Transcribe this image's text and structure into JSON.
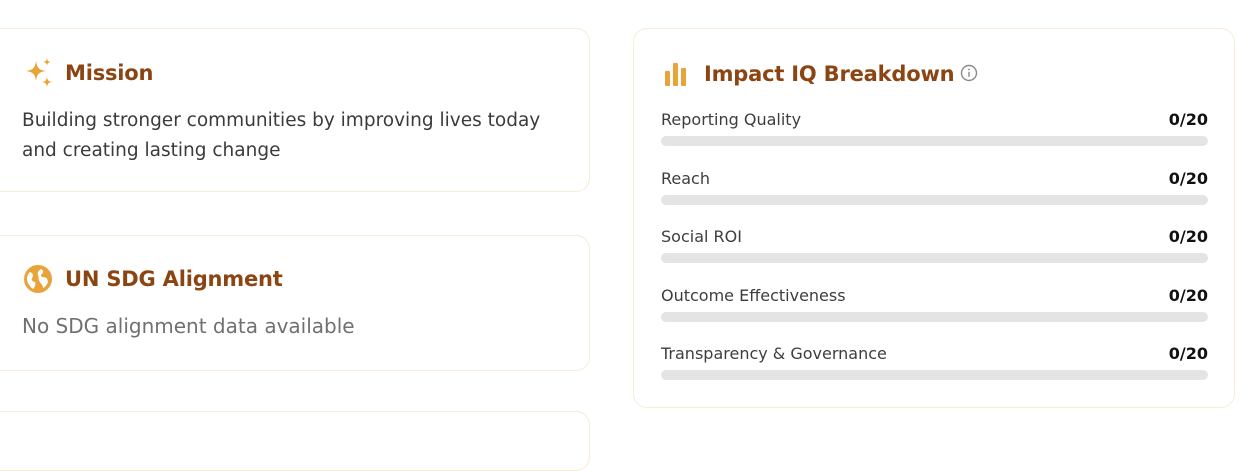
{
  "mission": {
    "title": "Mission",
    "text": "Building stronger communities by improving lives today and creating lasting change",
    "icon": "sparkles-icon"
  },
  "sdg": {
    "title": "UN SDG Alignment",
    "empty_text": "No SDG alignment data available",
    "icon": "globe-icon"
  },
  "impact": {
    "title": "Impact IQ Breakdown",
    "icon": "bar-chart-icon",
    "info_icon": "info-icon",
    "metrics": [
      {
        "label": "Reporting Quality",
        "score": "0/20",
        "fraction": 0
      },
      {
        "label": "Reach",
        "score": "0/20",
        "fraction": 0
      },
      {
        "label": "Social ROI",
        "score": "0/20",
        "fraction": 0
      },
      {
        "label": "Outcome Effectiveness",
        "score": "0/20",
        "fraction": 0
      },
      {
        "label": "Transparency & Governance",
        "score": "0/20",
        "fraction": 0
      }
    ]
  },
  "colors": {
    "accent": "#e8a33a",
    "title": "#8b4513",
    "card_border": "#f7edd2",
    "track": "#e4e4e4"
  }
}
